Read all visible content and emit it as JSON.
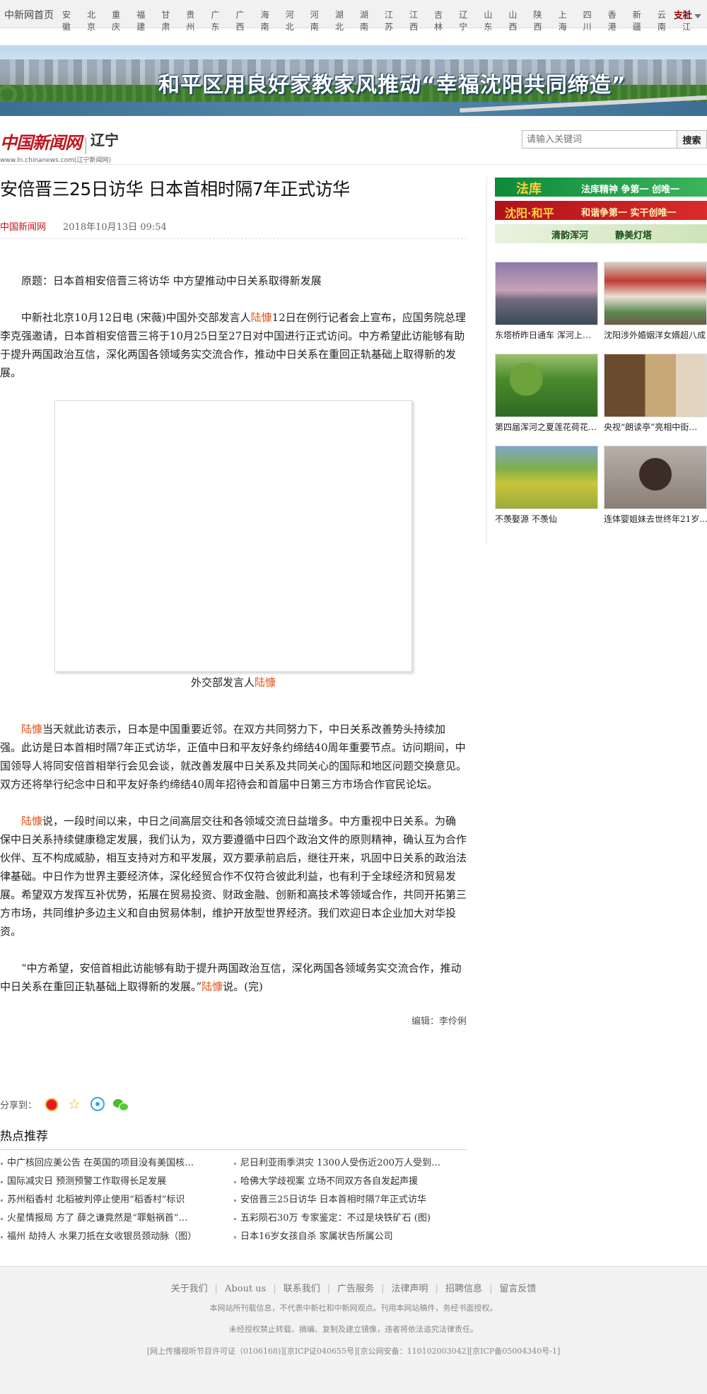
{
  "topnav": {
    "home": "中新网首页",
    "regions": [
      "安徽",
      "北京",
      "重庆",
      "福建",
      "甘肃",
      "贵州",
      "广东",
      "广西",
      "海南",
      "河北",
      "河南",
      "湖北",
      "湖南",
      "江苏",
      "江西",
      "吉林",
      "辽宁",
      "山东",
      "山西",
      "陕西",
      "上海",
      "四川",
      "香港",
      "新疆",
      "云南",
      "浙江"
    ],
    "branch": "支社"
  },
  "banner": {
    "title": "和平区用良好家教家风推动“幸福沈阳共同缔造”"
  },
  "logo": {
    "name": "中国新闻网",
    "region": "辽宁",
    "url": "www.ln.chinanews.com(辽宁新闻网)"
  },
  "search": {
    "placeholder": "请输入关键词",
    "button": "搜索"
  },
  "article": {
    "title": "安倍晋三25日访华 日本首相时隔7年正式访华",
    "source": "中国新闻网",
    "datetime": "2018年10月13日  09:54",
    "p1": "原题：日本首相安倍晋三将访华  中方望推动中日关系取得新发展",
    "p2_a": "中新社北京10月12日电 (宋薇)中国外交部发言人",
    "p2_name": "陆慷",
    "p2_b": "12日在例行记者会上宣布，应国务院总理李克强邀请，日本首相安倍晋三将于10月25日至27日对中国进行正式访问。中方希望此访能够有助于提升两国政治互信，深化两国各领域务实交流合作，推动中日关系在重回正轨基础上取得新的发展。",
    "caption_a": "外交部发言人",
    "caption_name": "陆慷",
    "p3_name": "陆慷",
    "p3_b": "当天就此访表示，日本是中国重要近邻。在双方共同努力下，中日关系改善势头持续加强。此访是日本首相时隔7年正式访华，正值中日和平友好条约缔结40周年重要节点。访问期间，中国领导人将同安倍首相举行会见会谈，就改善发展中日关系及共同关心的国际和地区问题交换意见。双方还将举行纪念中日和平友好条约缔结40周年招待会和首届中日第三方市场合作官民论坛。",
    "p4_name": "陆慷",
    "p4_b": "说，一段时间以来，中日之间高层交往和各领域交流日益增多。中方重视中日关系。为确保中日关系持续健康稳定发展，我们认为，双方要遵循中日四个政治文件的原则精神，确认互为合作伙伴、互不构成威胁，相互支持对方和平发展，双方要承前启后，继往开来，巩固中日关系的政治法律基础。中日作为世界主要经济体，深化经贸合作不仅符合彼此利益，也有利于全球经济和贸易发展。希望双方发挥互补优势，拓展在贸易投资、财政金融、创新和高技术等领域合作，共同开拓第三方市场，共同维护多边主义和自由贸易体制，维护开放型世界经济。我们欢迎日本企业加大对华投资。",
    "p5_a": "“中方希望，安倍首相此访能够有助于提升两国政治互信，深化两国各领域务实交流合作，推动中日关系在重回正轨基础上取得新的发展。”",
    "p5_name": "陆慷",
    "p5_b": "说。(完)",
    "editor": "编辑：李伶俐"
  },
  "share": {
    "label": "分享到："
  },
  "hot": {
    "title": "热点推荐",
    "items": [
      "中广核回应美公告 在英国的项目没有美国核…",
      "尼日利亚雨季洪灾 1300人受伤近200万人受到…",
      "国际减灾日 预测预警工作取得长足发展",
      "哈佛大学歧视案 立场不同双方各自发起声援",
      "苏州稻香村 北稻被判停止使用“稻香村”标识",
      "安倍晋三25日访华 日本首相时隔7年正式访华",
      "火星情报局 方了 薛之谦竟然是“罪魁祸首”…",
      "五彩陨石30万 专家鉴定：不过是块铁矿石 (图)",
      "福州 劫持人 水果刀抵在女收银员颈动脉（图）",
      "日本16岁女孩自杀 家属状告所属公司"
    ]
  },
  "sidebar": {
    "ads": [
      {
        "big": "法库",
        "small": "法库精神 争第一 创唯一"
      },
      {
        "big": "沈阳·和平",
        "small": "和谐争第一 实干创唯一"
      },
      {
        "big": "清韵浑河",
        "small": "静美灯塔"
      }
    ],
    "thumbs": [
      "东塔桥昨日通车 浑河上…",
      "沈阳涉外婚姻洋女婿超八成",
      "第四届浑河之夏莲花荷花…",
      "央视“朗读亭”亮相中街…",
      "不羡娶源 不羡仙",
      "连体婴姐妹去世终年21岁…"
    ]
  },
  "footer": {
    "links": [
      "关于我们",
      "About us",
      "联系我们",
      "广告服务",
      "法律声明",
      "招聘信息",
      "留言反馈"
    ],
    "note1": "本网站所刊载信息，不代表中新社和中新网观点。刊用本网站稿件，务经书面授权。",
    "note2": "未经授权禁止转载、摘编、复制及建立镜像，违者将依法追究法律责任。",
    "note3": "[网上传播视听节目许可证（0106168)][京ICP证040655号][京公网安备：110102003042][京ICP备05004340号-1]"
  },
  "colors": {
    "brand_red": "#c0161e",
    "name_highlight": "#e2541b"
  }
}
